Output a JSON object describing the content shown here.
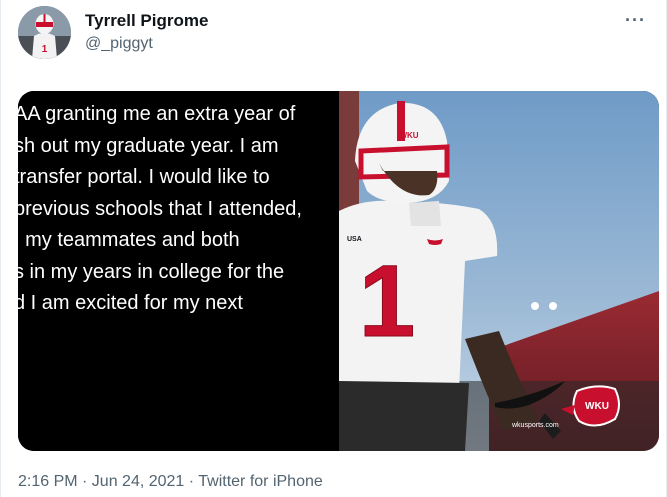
{
  "user": {
    "name": "Tyrrell Pigrome",
    "handle": "@_piggyt"
  },
  "tweet": {
    "notes_lines": [
      "AA granting me an extra year of",
      "sh out my graduate year. I am",
      "transfer portal. I would like to",
      "previous schools that I attended,",
      ", my teammates and both",
      "s in my years in college for the",
      "d I am excited for my next"
    ],
    "photo": {
      "jersey_number": "1",
      "helmet_text": "WKU",
      "sleeve_logo": "USA",
      "logo_text": "WKU",
      "watermark": "wkusports.com"
    },
    "timestamp": "2:16 PM · Jun 24, 2021 · Twitter for iPhone"
  },
  "icons": {
    "more": "more-horizontal-icon"
  },
  "colors": {
    "wku_red": "#c8102e",
    "text_primary": "#0f1419",
    "text_secondary": "#536471"
  }
}
